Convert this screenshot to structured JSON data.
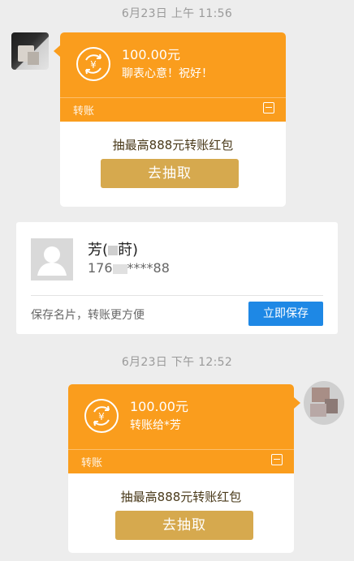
{
  "chat": {
    "timestamp1": "6月23日 上午 11:56",
    "timestamp2": "6月23日 下午 12:52"
  },
  "transfer1": {
    "amount": "100.00元",
    "note": "聊表心意！祝好！",
    "label": "转账",
    "promo": "抽最高888元转账红包",
    "button": "去抽取"
  },
  "namecard": {
    "name_prefix": "芳(",
    "name_suffix": "莳)",
    "phone_prefix": "176",
    "phone_suffix": "****88",
    "hint": "保存名片，转账更方便",
    "save_button": "立即保存"
  },
  "transfer2": {
    "amount": "100.00元",
    "note": "转账给*芳",
    "label": "转账",
    "promo": "抽最高888元转账红包",
    "button": "去抽取"
  },
  "colors": {
    "transfer_orange": "#fa9d1d",
    "button_gold": "#d6a94e",
    "save_blue": "#1e88e5"
  },
  "icons": [
    "transfer-coin-icon",
    "transfer-badge-icon",
    "default-avatar-icon"
  ]
}
